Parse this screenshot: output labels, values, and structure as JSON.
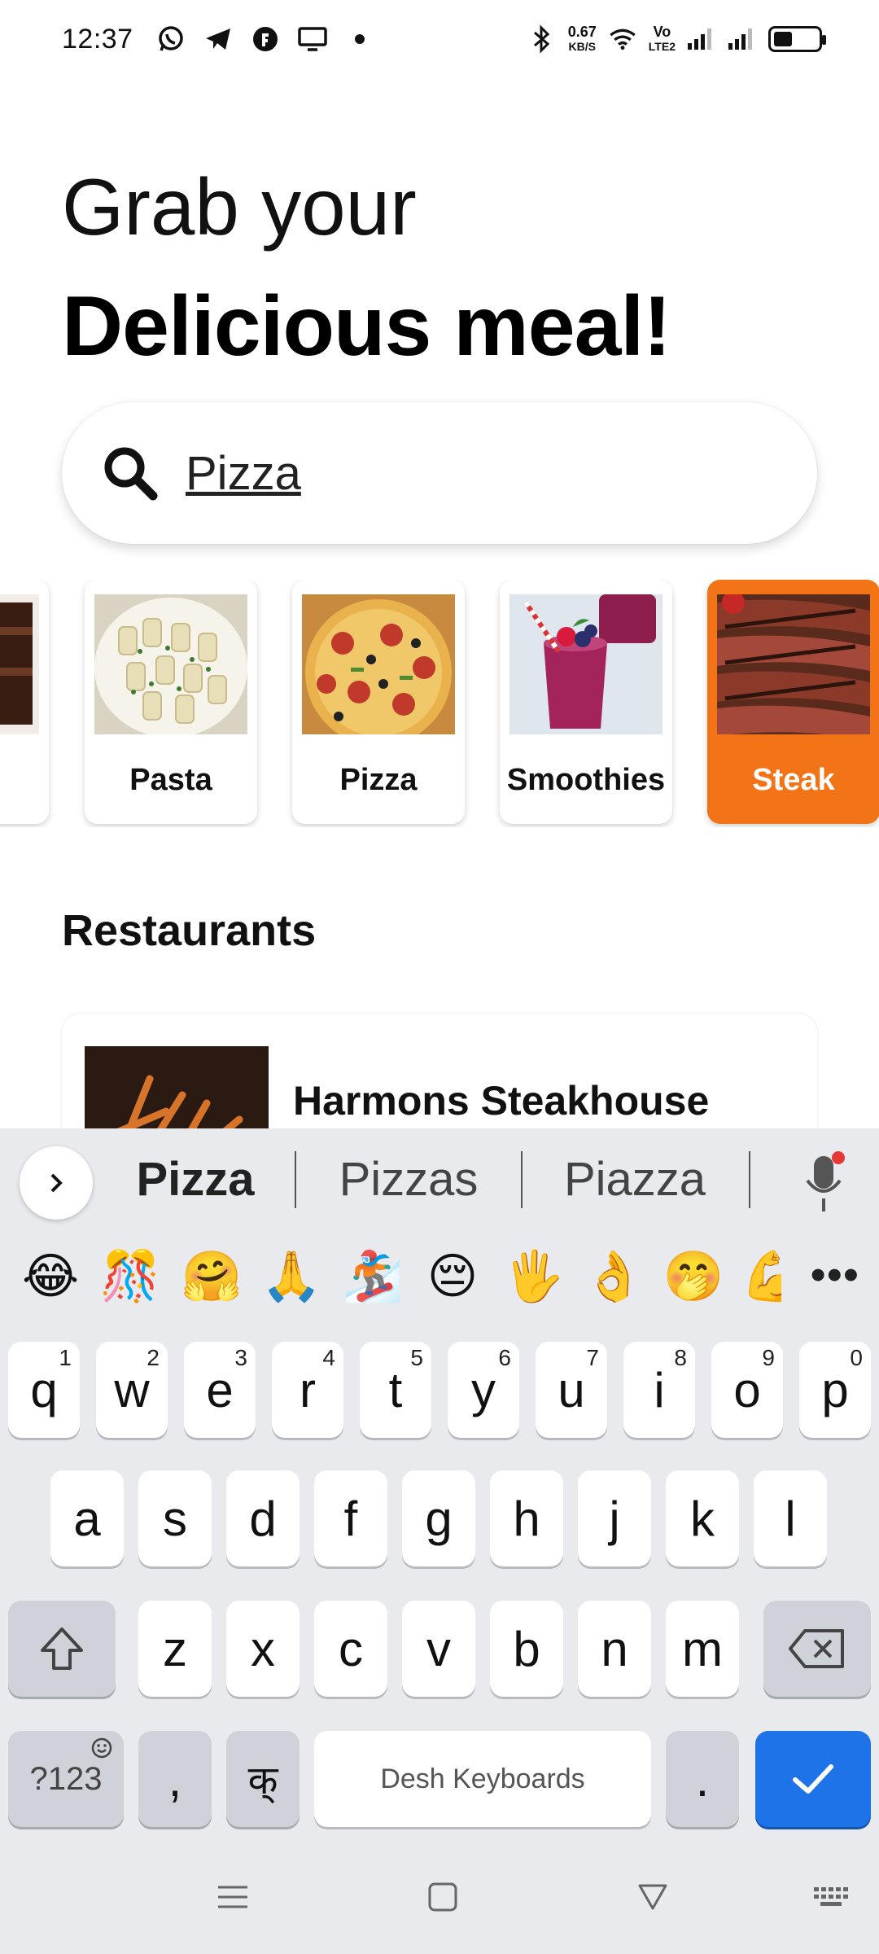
{
  "status_bar": {
    "time": "12:37",
    "net_speed": "0.67",
    "net_unit": "KB/S",
    "volte": "Vo",
    "lte": "LTE2",
    "left_icons": [
      "whatsapp-icon",
      "telegram-icon",
      "app-icon",
      "monitor-icon",
      "dot-icon"
    ],
    "right_icons": [
      "bluetooth-icon",
      "wifi-icon",
      "signal-icon",
      "signal-icon",
      "battery-icon"
    ]
  },
  "header": {
    "line1": "Grab your",
    "line2": "Delicious meal!"
  },
  "search": {
    "value": "Pizza",
    "icon": "search-icon"
  },
  "categories": [
    {
      "label": "",
      "image": "chocolate-cake"
    },
    {
      "label": "Pasta",
      "image": "pasta"
    },
    {
      "label": "Pizza",
      "image": "pizza"
    },
    {
      "label": "Smoothies",
      "image": "smoothie"
    },
    {
      "label": "Steak",
      "image": "steak",
      "active": true
    }
  ],
  "restaurants": {
    "title": "Restaurants",
    "items": [
      {
        "name": "Harmons Steakhouse",
        "image": "fries"
      }
    ]
  },
  "keyboard": {
    "suggestions": [
      "Pizza",
      "Pizzas",
      "Piazza"
    ],
    "emojis": [
      "😂",
      "🎊",
      "🤗",
      "🙏",
      "🏂",
      "😔",
      "🖐",
      "👌",
      "🤭",
      "💪"
    ],
    "row1": [
      "q",
      "w",
      "e",
      "r",
      "t",
      "y",
      "u",
      "i",
      "o",
      "p"
    ],
    "row1_sup": [
      "1",
      "2",
      "3",
      "4",
      "5",
      "6",
      "7",
      "8",
      "9",
      "0"
    ],
    "row2": [
      "a",
      "s",
      "d",
      "f",
      "g",
      "h",
      "j",
      "k",
      "l"
    ],
    "row3": [
      "z",
      "x",
      "c",
      "v",
      "b",
      "n",
      "m"
    ],
    "sym_label": "?123",
    "comma": ",",
    "lang_label": "क्",
    "space_label": "Desh Keyboards",
    "period": "."
  },
  "colors": {
    "accent": "#f37317",
    "keyboard_bg": "#e9eaee",
    "enter_blue": "#1f73e8"
  }
}
